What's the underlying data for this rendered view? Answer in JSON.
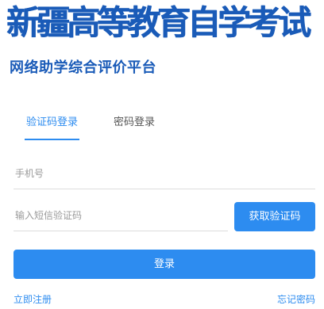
{
  "header": {
    "title": "新疆高等教育自学考试",
    "subtitle": "网络助学综合评价平台"
  },
  "tabs": {
    "sms_login": "验证码登录",
    "password_login": "密码登录",
    "active": "sms_login"
  },
  "form": {
    "phone_placeholder": "手机号",
    "phone_value": "",
    "code_placeholder": "输入短信验证码",
    "code_value": "",
    "get_code_label": "获取验证码",
    "login_label": "登录"
  },
  "links": {
    "register": "立即注册",
    "forgot_password": "忘记密码"
  },
  "colors": {
    "brand": "#1a5bb8",
    "accent": "#2d8cf0"
  }
}
